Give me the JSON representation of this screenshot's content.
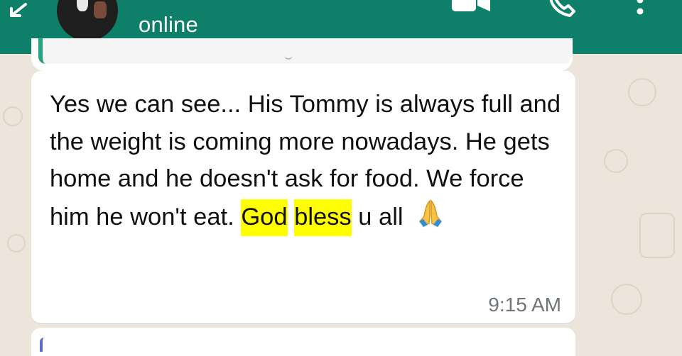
{
  "header": {
    "status": "online"
  },
  "message": {
    "text_before": "Yes we can see... His Tommy is always full and the weight is coming more nowadays. He gets home and he doesn't ask for food. We force him he won't eat.",
    "highlight_1": "God",
    "highlight_2": "bless",
    "text_after": "u all",
    "emoji": "folded-hands-icon",
    "time": "9:15 AM"
  },
  "colors": {
    "header_bg": "#0e8069",
    "wallpaper": "#ede5dc",
    "bubble": "#ffffff",
    "highlight": "#ffff00",
    "quote_accent": "#25a37f"
  },
  "icons": [
    "back-arrow-icon",
    "video-call-icon",
    "voice-call-icon",
    "more-options-icon"
  ]
}
